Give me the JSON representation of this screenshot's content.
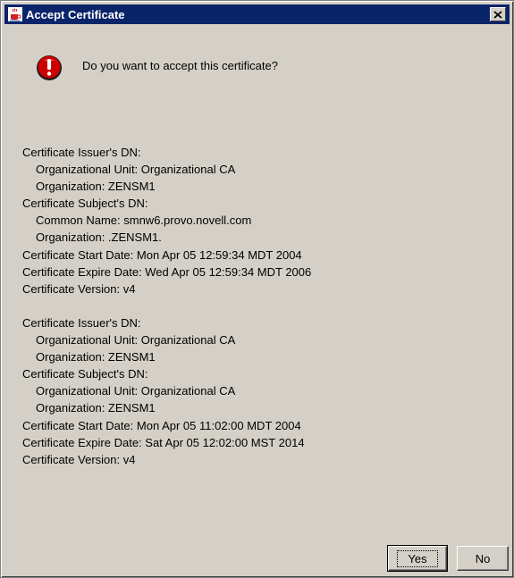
{
  "window": {
    "title": "Accept Certificate",
    "close_label": "×"
  },
  "dialog": {
    "question": "Do you want to accept this certificate?"
  },
  "certificates": [
    {
      "issuer_header": "Certificate Issuer's DN:",
      "issuer_ou": "Organizational Unit: Organizational CA",
      "issuer_org": "Organization: ZENSM1",
      "subject_header": "Certificate Subject's DN:",
      "subject_line1": "Common Name: smnw6.provo.novell.com",
      "subject_line2": "Organization: .ZENSM1.",
      "start_date": "Certificate Start Date: Mon Apr 05 12:59:34 MDT 2004",
      "expire_date": "Certificate Expire Date: Wed Apr 05 12:59:34 MDT 2006",
      "version": "Certificate Version: v4"
    },
    {
      "issuer_header": "Certificate Issuer's DN:",
      "issuer_ou": "Organizational Unit: Organizational CA",
      "issuer_org": "Organization: ZENSM1",
      "subject_header": "Certificate Subject's DN:",
      "subject_line1": "Organizational Unit: Organizational CA",
      "subject_line2": "Organization: ZENSM1",
      "start_date": "Certificate Start Date: Mon Apr 05 11:02:00 MDT 2004",
      "expire_date": "Certificate Expire Date: Sat Apr 05 12:02:00 MST 2014",
      "version": "Certificate Version: v4"
    }
  ],
  "buttons": {
    "yes_label": "Yes",
    "no_label": "No"
  },
  "colors": {
    "titlebar": "#0a246a",
    "dialog_background": "#d4d0c8",
    "warning_icon": "#cc0000"
  },
  "icons": {
    "title_icon": "java-coffee-cup-icon",
    "warning_icon": "exclamation-error-icon",
    "close_icon": "close-x-icon"
  }
}
